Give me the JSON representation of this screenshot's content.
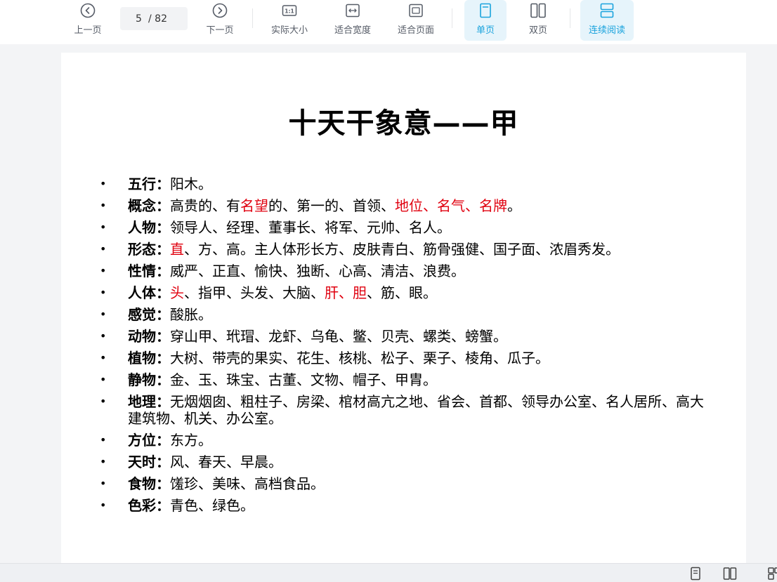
{
  "toolbar": {
    "prev_label": "上一页",
    "page_current": "5",
    "page_total": "/ 82",
    "next_label": "下一页",
    "actual_size_label": "实际大小",
    "fit_width_label": "适合宽度",
    "fit_page_label": "适合页面",
    "single_label": "单页",
    "double_label": "双页",
    "continuous_label": "连续阅读",
    "active_color": "#1aa3dd"
  },
  "document": {
    "title": "十天干象意——甲",
    "items": [
      {
        "key": "五行：",
        "segments": [
          {
            "t": "阳木。",
            "red": false
          }
        ]
      },
      {
        "key": "概念：",
        "segments": [
          {
            "t": "高贵的、有",
            "red": false
          },
          {
            "t": "名望",
            "red": true
          },
          {
            "t": "的、第一的、首领、",
            "red": false
          },
          {
            "t": "地位、名气、名牌",
            "red": true
          },
          {
            "t": "。",
            "red": false
          }
        ]
      },
      {
        "key": "人物：",
        "segments": [
          {
            "t": "领导人、经理、董事长、将军、元帅、名人。",
            "red": false
          }
        ]
      },
      {
        "key": "形态：",
        "segments": [
          {
            "t": "直",
            "red": true
          },
          {
            "t": "、方、高。主人体形长方、皮肤青白、筋骨强健、国子面、浓眉秀发。",
            "red": false
          }
        ]
      },
      {
        "key": "性情：",
        "segments": [
          {
            "t": "威严、正直、愉快、独断、心高、清洁、浪费。",
            "red": false
          }
        ]
      },
      {
        "key": "人体：",
        "segments": [
          {
            "t": "头",
            "red": true
          },
          {
            "t": "、指甲、头发、大脑、",
            "red": false
          },
          {
            "t": "肝、胆",
            "red": true
          },
          {
            "t": "、筋、眼。",
            "red": false
          }
        ]
      },
      {
        "key": "感觉：",
        "segments": [
          {
            "t": "酸胀。",
            "red": false
          }
        ]
      },
      {
        "key": "动物：",
        "segments": [
          {
            "t": "穿山甲、玳瑁、龙虾、乌龟、鳖、贝壳、螺类、螃蟹。",
            "red": false
          }
        ]
      },
      {
        "key": "植物：",
        "segments": [
          {
            "t": "大树、带壳的果实、花生、核桃、松子、栗子、棱角、瓜子。",
            "red": false
          }
        ]
      },
      {
        "key": "静物：",
        "segments": [
          {
            "t": "金、玉、珠宝、古董、文物、帽子、甲胄。",
            "red": false
          }
        ]
      },
      {
        "key": "地理：",
        "segments": [
          {
            "t": "无烟烟囱、粗柱子、房梁、棺材高亢之地、省会、首都、领导办公室、名人居所、高大建筑物、机关、办公室。",
            "red": false
          }
        ]
      },
      {
        "key": "方位：",
        "segments": [
          {
            "t": "东方。",
            "red": false
          }
        ]
      },
      {
        "key": "天时：",
        "segments": [
          {
            "t": "风、春天、早晨。",
            "red": false
          }
        ]
      },
      {
        "key": "食物：",
        "segments": [
          {
            "t": "馐珍、美味、高档食品。",
            "red": false
          }
        ]
      },
      {
        "key": "色彩：",
        "segments": [
          {
            "t": "青色、绿色。",
            "red": false
          }
        ]
      }
    ],
    "bullet": "•",
    "highlight_color": "#e0000f"
  }
}
